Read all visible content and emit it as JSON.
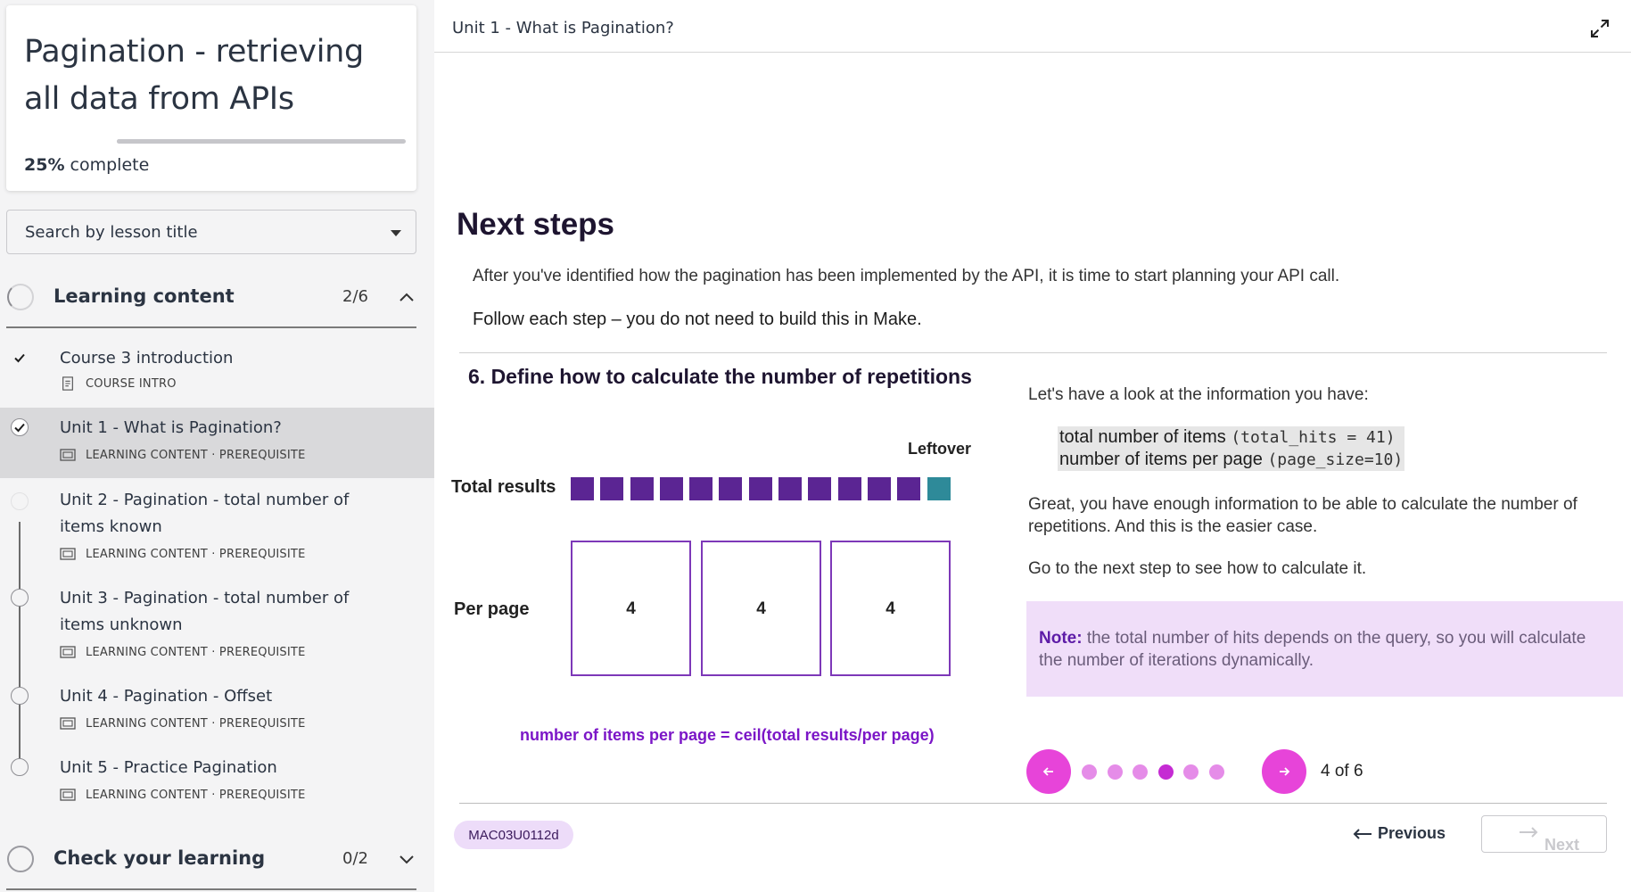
{
  "course": {
    "title": "Pagination - retrieving all data from APIs",
    "progress_percent": 25,
    "progress_value": "25%",
    "progress_suffix": " complete"
  },
  "search": {
    "label": "Search by lesson title"
  },
  "sections": [
    {
      "title": "Learning content",
      "count": "2/6",
      "expanded": true,
      "lessons": [
        {
          "title": "Course 3 introduction",
          "meta": "COURSE INTRO",
          "completed": true
        },
        {
          "title": "Unit 1 - What is Pagination?",
          "meta": "LEARNING CONTENT · PREREQUISITE",
          "completed": true,
          "active": true
        },
        {
          "title": "Unit 2 - Pagination - total number of items known",
          "meta": "LEARNING CONTENT · PREREQUISITE",
          "completed": false
        },
        {
          "title": "Unit 3 - Pagination - total number of items unknown",
          "meta": "LEARNING CONTENT · PREREQUISITE",
          "completed": false
        },
        {
          "title": "Unit 4 - Pagination - Offset",
          "meta": "LEARNING CONTENT · PREREQUISITE",
          "completed": false
        },
        {
          "title": "Unit 5 - Practice Pagination",
          "meta": "LEARNING CONTENT · PREREQUISITE",
          "completed": false
        }
      ]
    },
    {
      "title": "Check your learning",
      "count": "0/2",
      "expanded": false
    }
  ],
  "header": {
    "unit_title": "Unit 1 - What is Pagination?"
  },
  "content": {
    "heading": "Next steps",
    "intro": "After you've identified how the pagination has been implemented by the API, it is time to start planning your API call.",
    "follow": "Follow each step – you do not need to build this in Make.",
    "step_title": "6. Define how to calculate the number of repetitions",
    "diagram": {
      "leftover_label": "Leftover",
      "total_label": "Total results",
      "total_squares": 13,
      "leftover_squares": 1,
      "perpage_label": "Per page",
      "page_values": [
        "4",
        "4",
        "4"
      ],
      "formula": "number of items per page =  ceil(total results/per page)"
    },
    "info_lead": "Let's have a look at the information you have:",
    "info_items": [
      {
        "label": "total number of items",
        "code": "(total_hits = 41)"
      },
      {
        "label": "number of items per page",
        "code": "(page_size=10)"
      }
    ],
    "info_para": "Great, you have enough information to be able to calculate the number of repetitions. And this is the easier case.",
    "info_next": "Go to the next step to see how to calculate it.",
    "note_label": "Note:",
    "note_text": " the total number of hits depends on the query, so you will calculate the number of iterations dynamically."
  },
  "pager": {
    "total": 6,
    "current": 4,
    "label": "4 of 6"
  },
  "footer": {
    "code": "MAC03U0112d",
    "previous_label": "Previous",
    "next_label": "Next"
  },
  "colors": {
    "accent": "#e744d9",
    "dot": "#e58ce8",
    "dot_active": "#c52bd3",
    "square": "#5b2593",
    "leftover": "#2e8a99",
    "box_border": "#7d38b8",
    "formula": "#7b16c7",
    "note_bg": "#f0def9"
  }
}
